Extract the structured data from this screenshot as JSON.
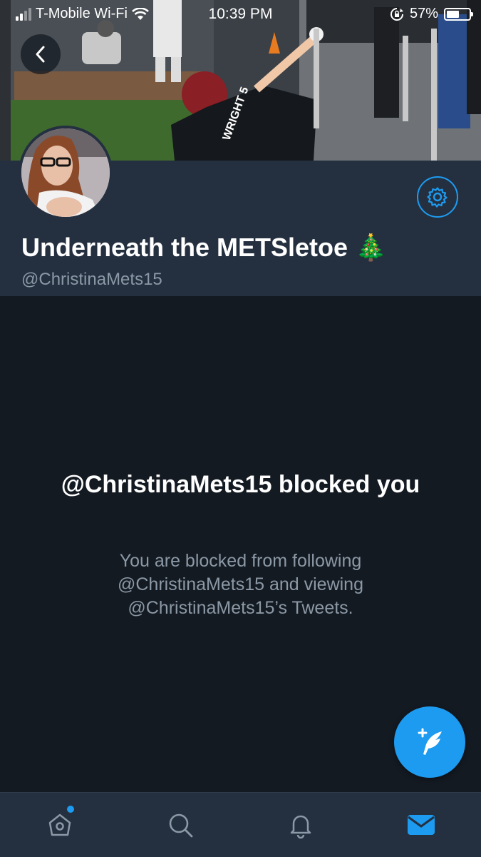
{
  "status_bar": {
    "carrier": "T-Mobile Wi-Fi",
    "time": "10:39 PM",
    "battery": "57%",
    "battery_level": 0.57
  },
  "profile": {
    "display_name": "Underneath the METSletoe 🎄",
    "handle": "@ChristinaMets15",
    "banner_jersey_text": "WRIGHT 5"
  },
  "blocked": {
    "title": "@ChristinaMets15 blocked you",
    "description": "You are blocked from following @ChristinaMets15 and viewing @ChristinaMets15’s Tweets."
  },
  "icons": {
    "back": "chevron-left-icon",
    "settings": "gear-icon",
    "compose": "compose-tweet-icon",
    "home": "home-icon",
    "search": "search-icon",
    "notifications": "bell-icon",
    "messages": "mail-icon"
  },
  "colors": {
    "accent": "#1d9bf0",
    "background": "#141a22",
    "header_bg": "#243040",
    "secondary_text": "#8b98a5"
  }
}
